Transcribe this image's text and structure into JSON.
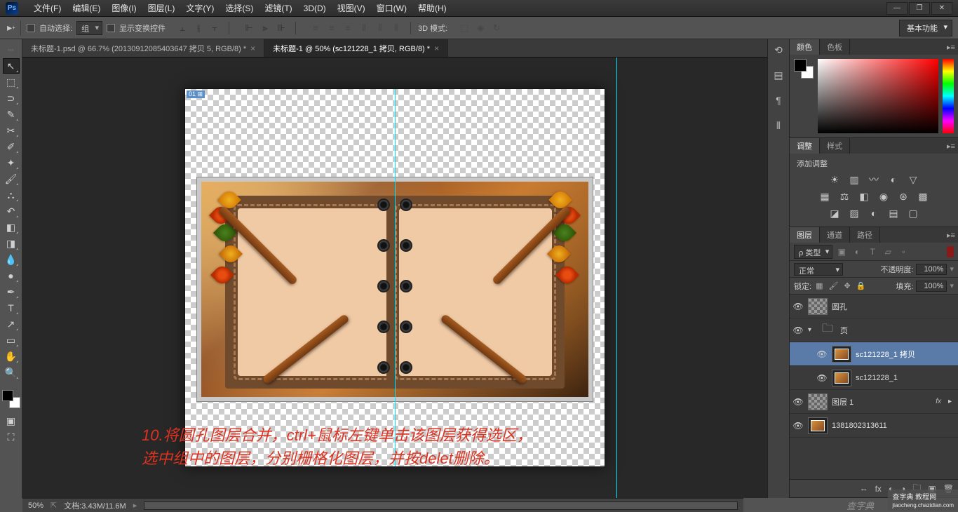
{
  "menu": [
    "文件(F)",
    "编辑(E)",
    "图像(I)",
    "图层(L)",
    "文字(Y)",
    "选择(S)",
    "滤镜(T)",
    "3D(D)",
    "视图(V)",
    "窗口(W)",
    "帮助(H)"
  ],
  "options": {
    "auto_select": "自动选择:",
    "group": "组",
    "show_transform": "显示变换控件",
    "mode_3d": "3D 模式:"
  },
  "workspace": "基本功能",
  "tabs": [
    {
      "title": "未标题-1.psd @ 66.7% (20130912085403647 拷贝 5, RGB/8) *",
      "active": false
    },
    {
      "title": "未标题-1 @ 50% (sc121228_1 拷贝, RGB/8) *",
      "active": true
    }
  ],
  "slice_label": "01",
  "annotation_line1": "10.将圆孔图层合并，ctrl+鼠标左键单击该图层获得选区，",
  "annotation_line2": "选中组中的图层，分别栅格化图层，并按delet删除。",
  "watermark1": "查字典",
  "watermark2_a": "查字典 教程网",
  "watermark2_b": "jiaocheng.chazidian.com",
  "panels": {
    "color_tabs": [
      "颜色",
      "色板"
    ],
    "adjust_tabs": [
      "调整",
      "样式"
    ],
    "adjust_label": "添加调整",
    "layers_tabs": [
      "图层",
      "通道",
      "路径"
    ]
  },
  "layer_filter": {
    "kind": "ρ 类型"
  },
  "blend": {
    "mode": "正常",
    "opacity_label": "不透明度:",
    "opacity_value": "100%",
    "lock_label": "锁定:",
    "fill_label": "填充:",
    "fill_value": "100%"
  },
  "layers": [
    {
      "name": "圆孔",
      "thumb": "trans",
      "indent": 0,
      "selected": false
    },
    {
      "name": "页",
      "thumb": "folder",
      "indent": 0,
      "selected": false,
      "open": true
    },
    {
      "name": "sc121228_1 拷贝",
      "thumb": "img",
      "indent": 2,
      "selected": true
    },
    {
      "name": "sc121228_1",
      "thumb": "img",
      "indent": 2,
      "selected": false
    },
    {
      "name": "图层 1",
      "thumb": "trans",
      "indent": 0,
      "selected": false,
      "fx": true
    },
    {
      "name": "1381802313611",
      "thumb": "img",
      "indent": 0,
      "selected": false
    }
  ],
  "status": {
    "zoom": "50%",
    "doc_info": "文档:3.43M/11.6M"
  }
}
